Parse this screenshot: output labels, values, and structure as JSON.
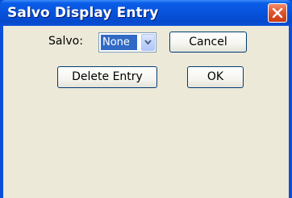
{
  "window": {
    "title": "Salvo Display Entry"
  },
  "form": {
    "salvo_label": "Salvo:",
    "salvo_selected": "None"
  },
  "buttons": {
    "cancel": "Cancel",
    "delete_entry": "Delete Entry",
    "ok": "OK"
  },
  "icons": {
    "close": "close-icon",
    "dropdown": "chevron-down-icon"
  },
  "colors": {
    "titlebar": "#0752dc",
    "client_bg": "#ece9d8",
    "selection": "#316ac5",
    "close_button": "#e2562f"
  }
}
